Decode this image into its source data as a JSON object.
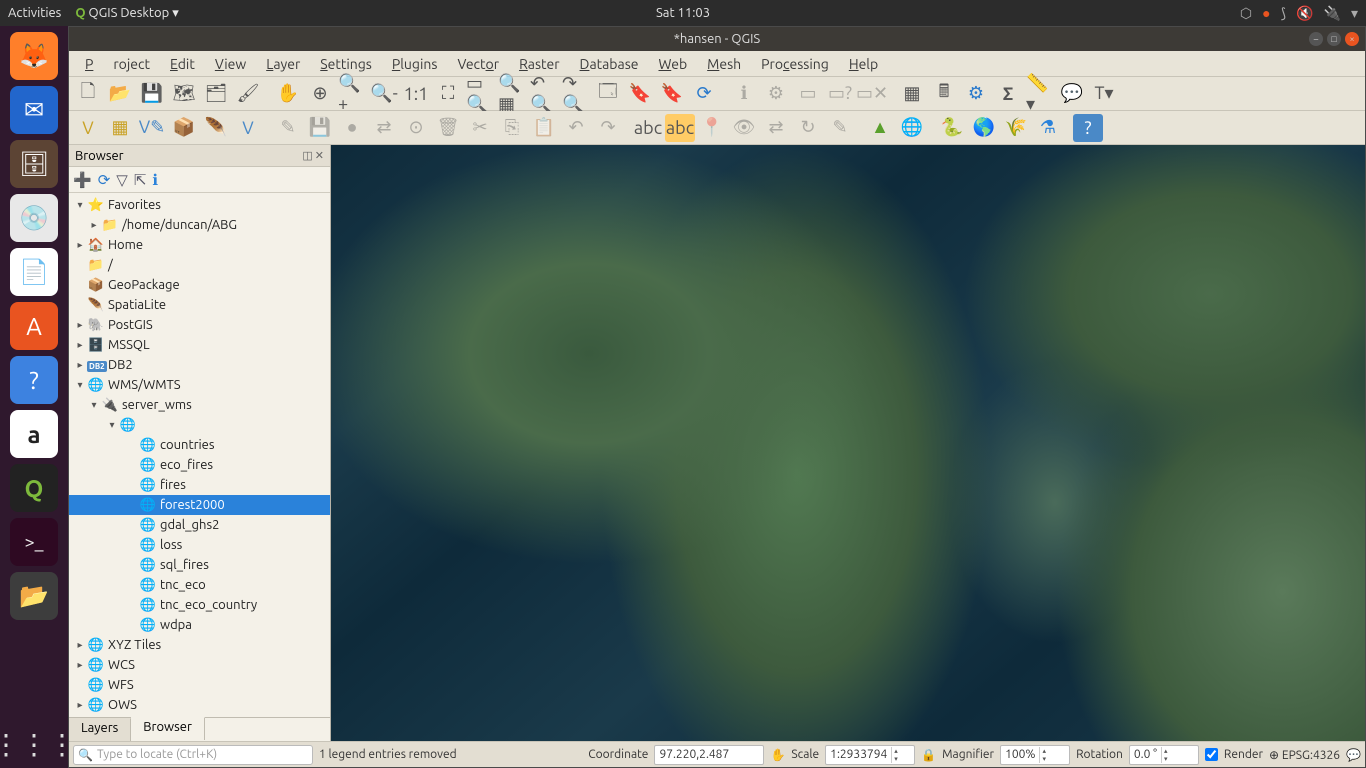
{
  "gnome": {
    "activities": "Activities",
    "app": "QGIS Desktop",
    "clock": "Sat 11:03"
  },
  "window": {
    "title": "*hansen - QGIS"
  },
  "menu": {
    "project": "Project",
    "edit": "Edit",
    "view": "View",
    "layer": "Layer",
    "settings": "Settings",
    "plugins": "Plugins",
    "vector": "Vector",
    "raster": "Raster",
    "database": "Database",
    "web": "Web",
    "mesh": "Mesh",
    "processing": "Processing",
    "help": "Help"
  },
  "browser": {
    "title": "Browser",
    "tabs": {
      "layers": "Layers",
      "browser": "Browser"
    },
    "tree": [
      {
        "l": 0,
        "exp": "▾",
        "icon": "⭐",
        "label": "Favorites",
        "color": "#f2c94c"
      },
      {
        "l": 1,
        "exp": "▸",
        "icon": "📁",
        "label": "/home/duncan/ABG"
      },
      {
        "l": 0,
        "exp": "▸",
        "icon": "🏠",
        "label": "Home"
      },
      {
        "l": 0,
        "exp": "",
        "icon": "📁",
        "label": "/"
      },
      {
        "l": 0,
        "exp": "",
        "icon": "📦",
        "label": "GeoPackage",
        "color": "#c9a227"
      },
      {
        "l": 0,
        "exp": "",
        "icon": "🪶",
        "label": "SpatiaLite",
        "color": "#4a89c7"
      },
      {
        "l": 0,
        "exp": "▸",
        "icon": "🐘",
        "label": "PostGIS",
        "color": "#4a89c7"
      },
      {
        "l": 0,
        "exp": "▸",
        "icon": "🗄️",
        "label": "MSSQL",
        "color": "#4a89c7"
      },
      {
        "l": 0,
        "exp": "▸",
        "icon": "DB2",
        "label": "DB2",
        "iconbg": "#4a89c7"
      },
      {
        "l": 0,
        "exp": "▾",
        "icon": "🌐",
        "label": "WMS/WMTS",
        "color": "#4a89c7"
      },
      {
        "l": 1,
        "exp": "▾",
        "icon": "🔌",
        "label": "server_wms",
        "color": "#c0a040"
      },
      {
        "l": 2,
        "exp": "▾",
        "icon": "🌐",
        "label": "",
        "color": "#4a89c7"
      },
      {
        "l": 3,
        "exp": "",
        "icon": "🌐",
        "label": "countries",
        "color": "#7aa7c7"
      },
      {
        "l": 3,
        "exp": "",
        "icon": "🌐",
        "label": "eco_fires",
        "color": "#7aa7c7"
      },
      {
        "l": 3,
        "exp": "",
        "icon": "🌐",
        "label": "fires",
        "color": "#7aa7c7"
      },
      {
        "l": 3,
        "exp": "",
        "icon": "🌐",
        "label": "forest2000",
        "color": "#7aa7c7",
        "selected": true
      },
      {
        "l": 3,
        "exp": "",
        "icon": "🌐",
        "label": "gdal_ghs2",
        "color": "#7aa7c7"
      },
      {
        "l": 3,
        "exp": "",
        "icon": "🌐",
        "label": "loss",
        "color": "#7aa7c7"
      },
      {
        "l": 3,
        "exp": "",
        "icon": "🌐",
        "label": "sql_fires",
        "color": "#7aa7c7"
      },
      {
        "l": 3,
        "exp": "",
        "icon": "🌐",
        "label": "tnc_eco",
        "color": "#7aa7c7"
      },
      {
        "l": 3,
        "exp": "",
        "icon": "🌐",
        "label": "tnc_eco_country",
        "color": "#7aa7c7"
      },
      {
        "l": 3,
        "exp": "",
        "icon": "🌐",
        "label": "wdpa",
        "color": "#7aa7c7"
      },
      {
        "l": 0,
        "exp": "▸",
        "icon": "🌐",
        "label": "XYZ Tiles",
        "color": "#4a89c7"
      },
      {
        "l": 0,
        "exp": "▸",
        "icon": "🌐",
        "label": "WCS",
        "color": "#4a89c7"
      },
      {
        "l": 0,
        "exp": "",
        "icon": "🌐",
        "label": "WFS",
        "color": "#4a89c7"
      },
      {
        "l": 0,
        "exp": "▸",
        "icon": "🌐",
        "label": "OWS",
        "color": "#4a89c7"
      }
    ]
  },
  "status": {
    "locator_placeholder": "Type to locate (Ctrl+K)",
    "msg": "1 legend entries removed",
    "coord_label": "Coordinate",
    "coord_value": "97.220,2.487",
    "scale_label": "Scale",
    "scale_value": "1:2933794",
    "mag_label": "Magnifier",
    "mag_value": "100%",
    "rot_label": "Rotation",
    "rot_value": "0.0 °",
    "render": "Render",
    "crs": "EPSG:4326"
  }
}
